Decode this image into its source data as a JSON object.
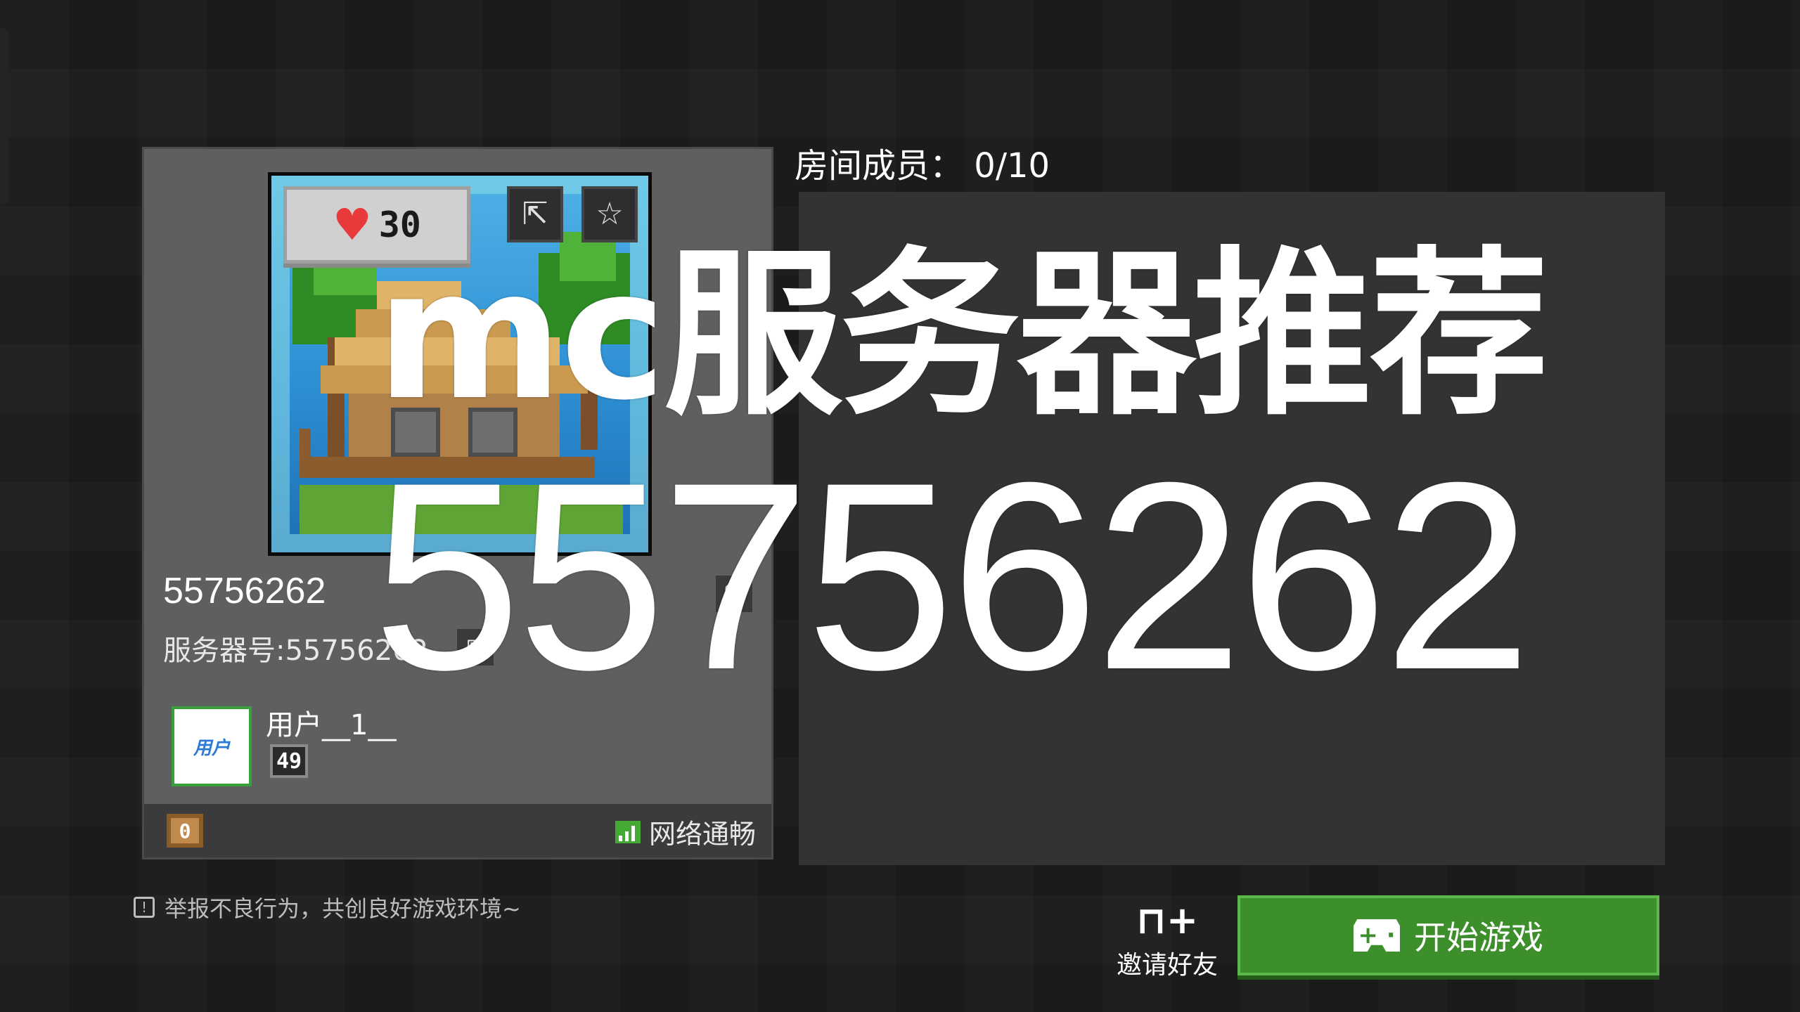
{
  "server_card": {
    "likes": "30",
    "share_icon": "share-icon",
    "favorite_icon": "star-icon",
    "name": "55756262",
    "server_id": "服务器号:55756262",
    "owner": {
      "avatar_text": "用户",
      "name": "用户__1__",
      "level": "49"
    },
    "footer": {
      "status_chip": "0",
      "network_status": "网络通畅"
    }
  },
  "room": {
    "label": "房间成员：",
    "count": "0/10"
  },
  "overlay": {
    "title": "mc服务器推荐",
    "number": "55756262"
  },
  "bottom": {
    "report_text": "举报不良行为，共创良好游戏环境~",
    "invite_label": "邀请好友",
    "start_label": "开始游戏"
  },
  "colors": {
    "background": "#1c1c1c",
    "card": "#5f5f5f",
    "panel": "#333335",
    "accent_green": "#3d8f2c"
  }
}
